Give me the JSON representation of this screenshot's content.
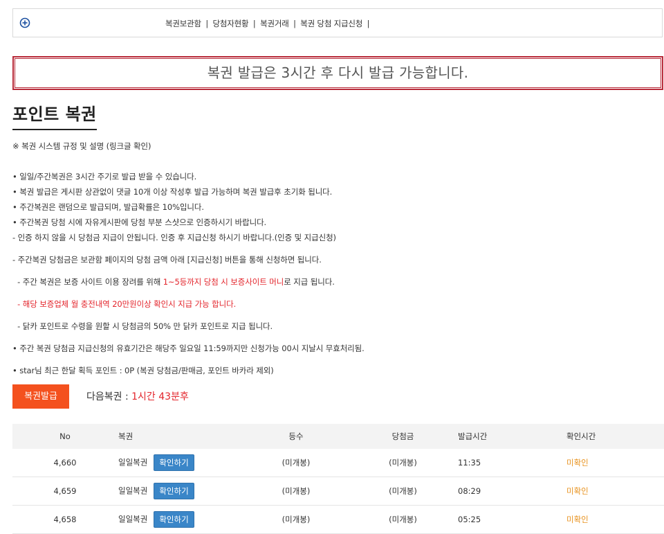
{
  "nav": {
    "links": [
      "복권보관함",
      "당첨자현황",
      "복권거래",
      "복권 당첨 지급신청"
    ],
    "separator": "|"
  },
  "alert": {
    "message": "복권 발급은 3시간 후 다시 발급 가능합니다."
  },
  "page": {
    "title": "포인트 복권"
  },
  "notes": {
    "header": "※ 복권 시스템 규정 및 설명 (링크글 확인)",
    "lines": [
      "• 일일/주간복권은 3시간 주기로 발급 받을 수 있습니다.",
      "• 복권 발급은 게시판 상관없이 댓글 10개 이상 작성후 발급 가능하며 복권 발급후 초기화 됩니다.",
      "• 주간복권은 랜덤으로 발급되며, 발급확률은 10%입니다.",
      "• 주간복권 당첨 시에 자유게시판에 당첨 부분 스샷으로 인증하시기 바랍니다.",
      "  - 인증 하지 않을 시 당첨금 지급이 안됩니다. 인증 후 지급신청 하시기 바랍니다.(인증 및 지급신청)",
      "  - 주간복권 당첨금은 보관함 페이지의 당첨 금액 아래 [지급신청] 버튼을 통해 신청하면 됩니다."
    ],
    "line7_prefix": "  - 주간 복권은 보증 사이트 이용 장려를 위해 ",
    "line7_red": "1~5등까지 당첨 시 보증사이트 머니",
    "line7_suffix": "로 지급 됩니다.",
    "line8": "  - 해당 보증업체 월 충전내역 20만원이상 확인시 지급 가능 합니다.",
    "line9": "  - 닭카 포인트로 수령을 원할 시 당첨금의 50% 만 닭카 포인트로 지급 됩니다.",
    "line10": "• 주간 복권 당첨금 지급신청의 유효기간은 해당주 일요일 11:59까지만 신청가능 00시 지날시 무효처리됨.",
    "line11": "• star님 최근 한달 획득 포인트 : 0P (복권 당첨금/판매금, 포인트 바카라 제외)"
  },
  "issue": {
    "button_label": "복권발급",
    "next_label": "다음복권 : ",
    "next_value": "1시간 43분후"
  },
  "table": {
    "headers": [
      "No",
      "복권",
      "등수",
      "당첨금",
      "발급시간",
      "확인시간"
    ],
    "rows": [
      {
        "no": "4,660",
        "name": "일일복권",
        "action": "확인하기",
        "rank": "(미개봉)",
        "prize": "(미개봉)",
        "time": "11:35",
        "check": "미확인"
      },
      {
        "no": "4,659",
        "name": "일일복권",
        "action": "확인하기",
        "rank": "(미개봉)",
        "prize": "(미개봉)",
        "time": "08:29",
        "check": "미확인"
      },
      {
        "no": "4,658",
        "name": "일일복권",
        "action": "확인하기",
        "rank": "(미개봉)",
        "prize": "(미개봉)",
        "time": "05:25",
        "check": "미확인"
      }
    ]
  },
  "colors": {
    "alert_border": "#b82a39",
    "accent_red": "#e3242b",
    "issue_button": "#f4511e",
    "confirm_button": "#3a86c8",
    "unconfirmed": "#e89320"
  }
}
